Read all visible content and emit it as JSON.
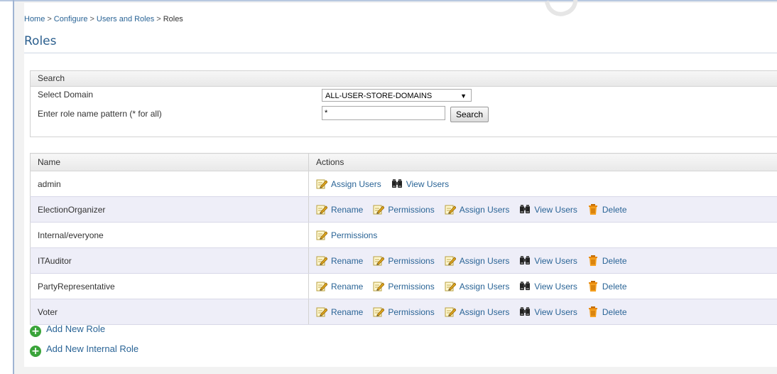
{
  "breadcrumb": [
    {
      "label": "Home"
    },
    {
      "label": "Configure"
    },
    {
      "label": "Users and Roles"
    },
    {
      "label": "Roles"
    }
  ],
  "breadcrumb_separator": ">",
  "page_title": "Roles",
  "search": {
    "header": "Search",
    "domain_label": "Select Domain",
    "domain_value": "ALL-USER-STORE-DOMAINS",
    "pattern_label": "Enter role name pattern (* for all)",
    "pattern_value": "*",
    "search_button": "Search"
  },
  "table": {
    "col_name": "Name",
    "col_actions": "Actions",
    "rows": [
      {
        "name": "admin",
        "actions": [
          "Assign Users",
          "View Users"
        ]
      },
      {
        "name": "ElectionOrganizer",
        "actions": [
          "Rename",
          "Permissions",
          "Assign Users",
          "View Users",
          "Delete"
        ]
      },
      {
        "name": "Internal/everyone",
        "actions": [
          "Permissions"
        ]
      },
      {
        "name": "ITAuditor",
        "actions": [
          "Rename",
          "Permissions",
          "Assign Users",
          "View Users",
          "Delete"
        ]
      },
      {
        "name": "PartyRepresentative",
        "actions": [
          "Rename",
          "Permissions",
          "Assign Users",
          "View Users",
          "Delete"
        ]
      },
      {
        "name": "Voter",
        "actions": [
          "Rename",
          "Permissions",
          "Assign Users",
          "View Users",
          "Delete"
        ]
      }
    ]
  },
  "links": {
    "add_role": "Add New Role",
    "add_internal_role": "Add New Internal Role"
  },
  "colors": {
    "link": "#2a6496",
    "title": "#2b5f8e",
    "alt_row": "#eeeef8",
    "add_icon": "#3aa43a",
    "delete_icon": "#e8890c"
  }
}
